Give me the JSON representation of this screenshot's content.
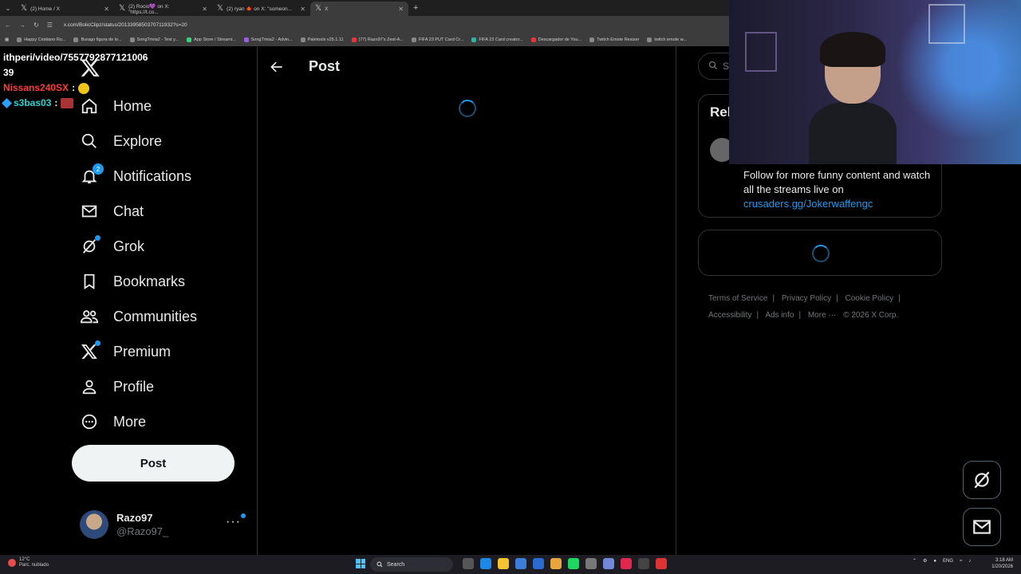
{
  "browser": {
    "tabs": [
      {
        "title": "(2) Home / X",
        "active": false
      },
      {
        "title": "(2) Rocio💜 on X: \"https://t.co...",
        "active": false
      },
      {
        "title": "(2) ryan 🍁 on X: \"someon...",
        "active": false
      },
      {
        "title": "X",
        "active": true
      }
    ],
    "new_tab": "+",
    "url": "x.com/BolicClipz/status/2013395850370711932?s=20",
    "bookmarks": [
      "Happy Cristiano Ro...",
      "Burago figura de lo...",
      "SongTrivia2 - Test y...",
      "App Store / Streami...",
      "SongTrivia2 - Advin...",
      "Paletools v25.1.11",
      "(77) Razo97's Zest-A...",
      "FIFA 23 PUT Card Cr...",
      "FIFA 23 Card creator...",
      "Descargador de You...",
      "Twitch Emote Resizer",
      "twitch emote w..."
    ]
  },
  "overlay": {
    "line1": "ithperi/video/7557792877121006",
    "line2": "39",
    "chat": [
      {
        "user": "Nissans240SX",
        "sep": ":"
      },
      {
        "user": "s3bas03",
        "sep": ":"
      }
    ]
  },
  "sidebar": {
    "nav": [
      {
        "label": "Home",
        "icon": "home-icon"
      },
      {
        "label": "Explore",
        "icon": "search-icon"
      },
      {
        "label": "Notifications",
        "icon": "bell-icon",
        "badge": "2"
      },
      {
        "label": "Chat",
        "icon": "mail-icon"
      },
      {
        "label": "Grok",
        "icon": "grok-icon"
      },
      {
        "label": "Bookmarks",
        "icon": "bookmark-icon"
      },
      {
        "label": "Communities",
        "icon": "communities-icon"
      },
      {
        "label": "Premium",
        "icon": "x-premium-icon"
      },
      {
        "label": "Profile",
        "icon": "person-icon"
      },
      {
        "label": "More",
        "icon": "more-circle-icon"
      }
    ],
    "post_button": "Post",
    "account": {
      "name": "Razo97",
      "handle": "@Razo97_",
      "more": "···"
    }
  },
  "main": {
    "title": "Post"
  },
  "right": {
    "search_placeholder": "S",
    "relevant_title": "Rel",
    "bio_text": "Follow for more funny content and watch all the streams live on",
    "bio_link": "crusaders.gg/Jokerwaffengc",
    "footer": {
      "terms": "Terms of Service",
      "privacy": "Privacy Policy",
      "cookie": "Cookie Policy",
      "accessibility": "Accessibility",
      "ads": "Ads info",
      "more": "More ···",
      "copyright": "© 2026 X Corp."
    }
  },
  "taskbar": {
    "temp": "12°C",
    "weather": "Parc. nublado",
    "search": "Search",
    "lang": "ENG",
    "time": "3:18 AM",
    "date": "1/20/2026"
  },
  "colors": {
    "accent": "#1d9bf0",
    "background": "#000000",
    "border": "#2f3336",
    "text": "#e7e9ea",
    "muted": "#71767b"
  }
}
